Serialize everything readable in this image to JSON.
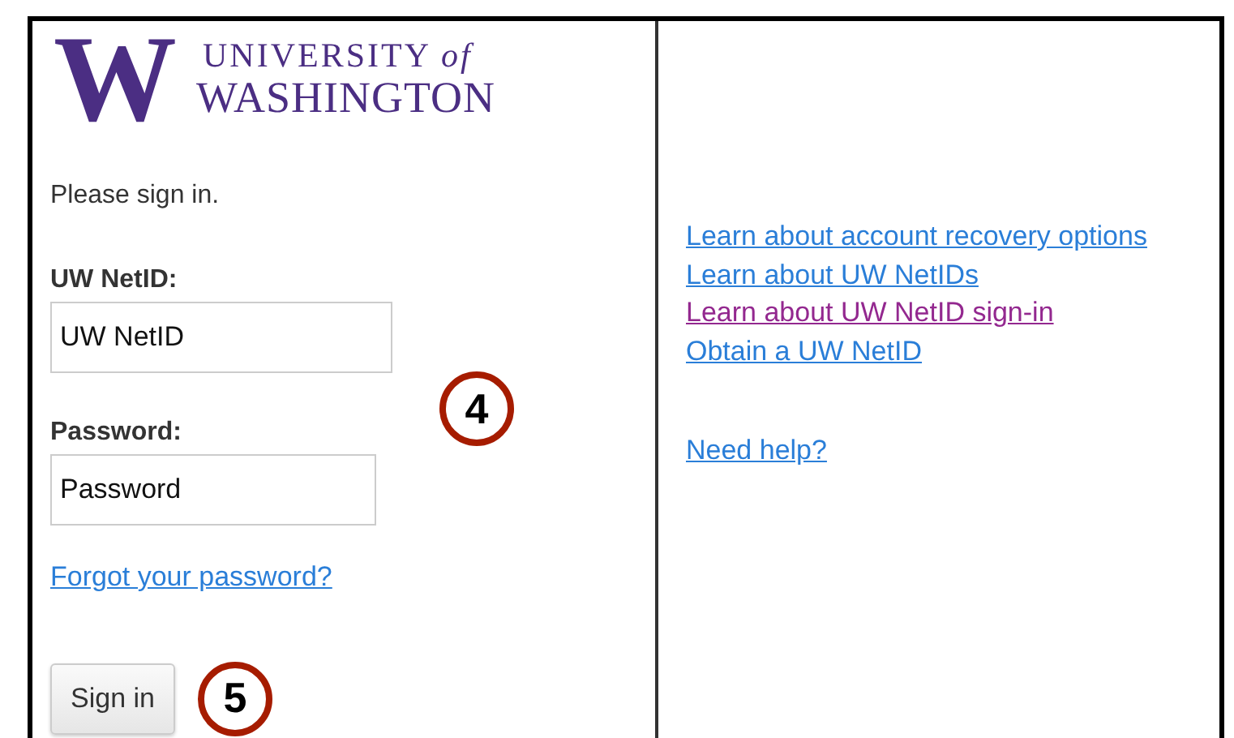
{
  "logo": {
    "letter": "W",
    "line_1": "UNIVERSITY *of*",
    "line_2": "WASHINGTON"
  },
  "intro": "Please sign in.",
  "fields": [
    {
      "label": "UW NetID:",
      "value": "UW NetID"
    },
    {
      "label": "Password:",
      "value": "Password"
    }
  ],
  "forgot_link": {
    "text": "Forgot your password?",
    "visited": false
  },
  "sign_in_button": "Sign in",
  "links": [
    {
      "text": "Learn about account recovery options",
      "visited": false
    },
    {
      "text": "Learn about UW NetIDs",
      "visited": false
    },
    {
      "text": "Learn about UW NetID sign-in",
      "visited": true
    },
    {
      "text": "Obtain a UW NetID",
      "visited": false
    }
  ],
  "help_link": {
    "text": "Need help?",
    "visited": false
  },
  "callouts": [
    "4",
    "5"
  ]
}
